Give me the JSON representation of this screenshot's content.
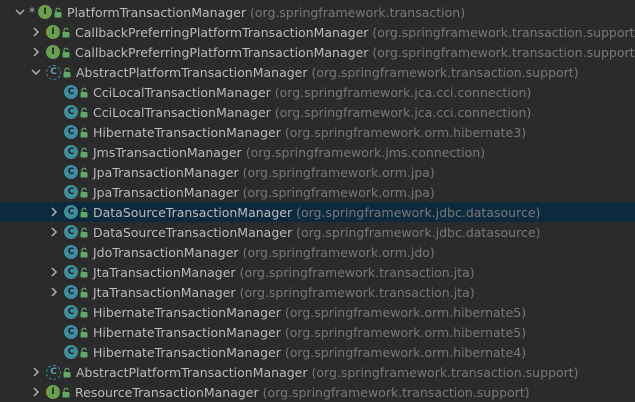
{
  "rows": [
    {
      "name": "PlatformTransactionManager",
      "pkg": "(org.springframework.transaction)",
      "kind": "interface",
      "icon_letter": "I",
      "arrow": "expanded",
      "level": 0,
      "star": "*"
    },
    {
      "name": "CallbackPreferringPlatformTransactionManager",
      "pkg": "(org.springframework.transaction.support)",
      "kind": "interface",
      "icon_letter": "I",
      "arrow": "collapsed",
      "level": 1
    },
    {
      "name": "CallbackPreferringPlatformTransactionManager",
      "pkg": "(org.springframework.transaction.support)",
      "kind": "interface",
      "icon_letter": "I",
      "arrow": "collapsed",
      "level": 1
    },
    {
      "name": "AbstractPlatformTransactionManager",
      "pkg": "(org.springframework.transaction.support)",
      "kind": "abstract",
      "icon_letter": "C",
      "arrow": "expanded",
      "level": 1
    },
    {
      "name": "CciLocalTransactionManager",
      "pkg": "(org.springframework.jca.cci.connection)",
      "kind": "class",
      "icon_letter": "C",
      "arrow": "none",
      "level": 2
    },
    {
      "name": "CciLocalTransactionManager",
      "pkg": "(org.springframework.jca.cci.connection)",
      "kind": "class",
      "icon_letter": "C",
      "arrow": "none",
      "level": 2
    },
    {
      "name": "HibernateTransactionManager",
      "pkg": "(org.springframework.orm.hibernate3)",
      "kind": "class",
      "icon_letter": "C",
      "arrow": "none",
      "level": 2
    },
    {
      "name": "JmsTransactionManager",
      "pkg": "(org.springframework.jms.connection)",
      "kind": "class",
      "icon_letter": "C",
      "arrow": "none",
      "level": 2
    },
    {
      "name": "JpaTransactionManager",
      "pkg": "(org.springframework.orm.jpa)",
      "kind": "class",
      "icon_letter": "C",
      "arrow": "none",
      "level": 2
    },
    {
      "name": "JpaTransactionManager",
      "pkg": "(org.springframework.orm.jpa)",
      "kind": "class",
      "icon_letter": "C",
      "arrow": "none",
      "level": 2
    },
    {
      "name": "DataSourceTransactionManager",
      "pkg": "(org.springframework.jdbc.datasource)",
      "kind": "class",
      "icon_letter": "C",
      "arrow": "collapsed",
      "level": 2,
      "selected": true
    },
    {
      "name": "DataSourceTransactionManager",
      "pkg": "(org.springframework.jdbc.datasource)",
      "kind": "class",
      "icon_letter": "C",
      "arrow": "collapsed",
      "level": 2
    },
    {
      "name": "JdoTransactionManager",
      "pkg": "(org.springframework.orm.jdo)",
      "kind": "class",
      "icon_letter": "C",
      "arrow": "none",
      "level": 2
    },
    {
      "name": "JtaTransactionManager",
      "pkg": "(org.springframework.transaction.jta)",
      "kind": "class",
      "icon_letter": "C",
      "arrow": "collapsed",
      "level": 2
    },
    {
      "name": "JtaTransactionManager",
      "pkg": "(org.springframework.transaction.jta)",
      "kind": "class",
      "icon_letter": "C",
      "arrow": "collapsed",
      "level": 2
    },
    {
      "name": "HibernateTransactionManager",
      "pkg": "(org.springframework.orm.hibernate5)",
      "kind": "class",
      "icon_letter": "C",
      "arrow": "none",
      "level": 2
    },
    {
      "name": "HibernateTransactionManager",
      "pkg": "(org.springframework.orm.hibernate5)",
      "kind": "class",
      "icon_letter": "C",
      "arrow": "none",
      "level": 2
    },
    {
      "name": "HibernateTransactionManager",
      "pkg": "(org.springframework.orm.hibernate4)",
      "kind": "class",
      "icon_letter": "C",
      "arrow": "none",
      "level": 2
    },
    {
      "name": "AbstractPlatformTransactionManager",
      "pkg": "(org.springframework.transaction.support)",
      "kind": "abstract",
      "icon_letter": "C",
      "arrow": "collapsed",
      "level": 1
    },
    {
      "name": "ResourceTransactionManager",
      "pkg": "(org.springframework.transaction.support)",
      "kind": "interface",
      "icon_letter": "I",
      "arrow": "collapsed",
      "level": 1
    }
  ],
  "colors": {
    "background": "#2b2b2b",
    "selection": "#0d293e",
    "class_icon": "#3f8c9e",
    "interface_icon": "#6a9f4f",
    "name_text": "#bbbbbb",
    "package_text": "#787878"
  }
}
